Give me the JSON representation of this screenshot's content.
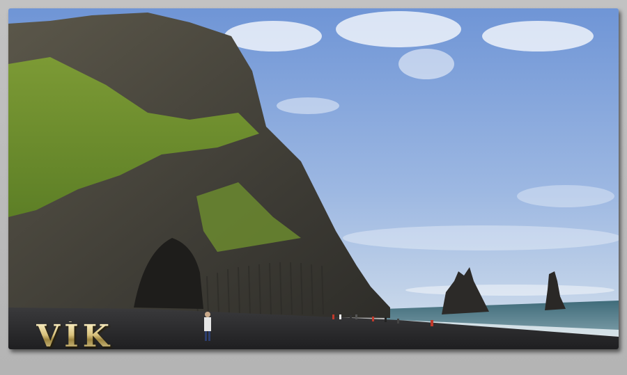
{
  "caption": {
    "title": "VÍK"
  },
  "scene": {
    "sky_color": "#8fb0e0",
    "sea_color": "#5e7f8a",
    "sand_color": "#2b2b2d",
    "grass_color": "#6a8f2e",
    "rock_color": "#4f4c42"
  }
}
